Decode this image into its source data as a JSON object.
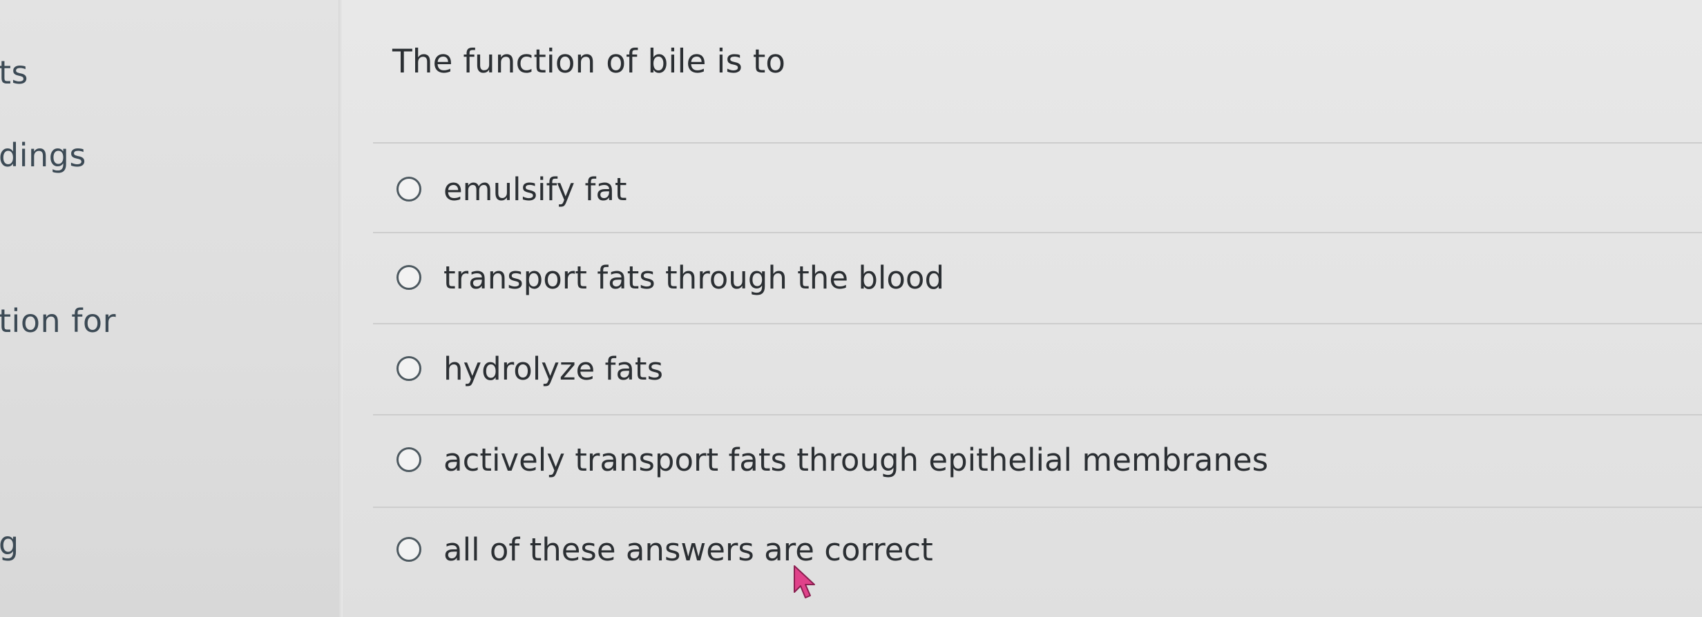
{
  "sidebar": {
    "items": [
      {
        "label": "ts"
      },
      {
        "label": "dings"
      },
      {
        "label": "tion for"
      },
      {
        "label": "g"
      }
    ]
  },
  "question": {
    "text": "The function of bile is to",
    "answers": [
      {
        "label": "emulsify fat",
        "selected": false
      },
      {
        "label": "transport fats through the blood",
        "selected": false
      },
      {
        "label": "hydrolyze fats",
        "selected": false
      },
      {
        "label": "actively transport fats through epithelial membranes",
        "selected": false
      },
      {
        "label": "all of these answers are correct",
        "selected": false
      }
    ]
  },
  "colors": {
    "cursor": "#e0428a",
    "radio_border": "#4d5960",
    "text": "#2b2f33"
  },
  "icons": {
    "cursor": "mouse-pointer-icon"
  }
}
